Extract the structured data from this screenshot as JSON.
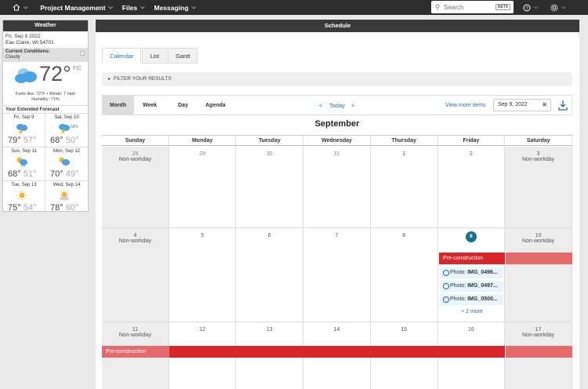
{
  "nav": {
    "items": [
      {
        "label": "Project Management"
      },
      {
        "label": "Files"
      },
      {
        "label": "Messaging"
      }
    ],
    "search_placeholder": "Search",
    "beta": "BETA"
  },
  "weather": {
    "title": "Weather",
    "date": "Fri, Sep 9 2022",
    "location": "Eau Claire, WI 54701",
    "conditions_label": "Current Conditions:",
    "conditions": "Cloudy",
    "temp": "72°",
    "unit": "F|C",
    "feels": "Feels like: 72°F • Winds: 7 mph",
    "humidity": "Humidity: 71%",
    "extended_label": "Your Extended Forecast",
    "forecast": [
      {
        "day": "Fri, Sep 9",
        "hi": "79°",
        "lo": "57°",
        "pct": "",
        "icon": "storm-cloud-icon"
      },
      {
        "day": "Sat, Sep 10",
        "hi": "68°",
        "lo": "50°",
        "pct": "58%",
        "icon": "storm-cloud-icon"
      },
      {
        "day": "Sun, Sep 11",
        "hi": "68°",
        "lo": "51°",
        "pct": "",
        "icon": "partly-cloudy-icon"
      },
      {
        "day": "Mon, Sep 12",
        "hi": "70°",
        "lo": "49°",
        "pct": "",
        "icon": "partly-cloudy-icon"
      },
      {
        "day": "Tue, Sep 13",
        "hi": "75°",
        "lo": "54°",
        "pct": "",
        "icon": "sun-icon"
      },
      {
        "day": "Wed, Sep 14",
        "hi": "78°",
        "lo": "60°",
        "pct": "",
        "icon": "sun-cloud-icon"
      }
    ]
  },
  "schedule": {
    "title": "Schedule",
    "tabs": [
      "Calendar",
      "List",
      "Gantt"
    ],
    "filter": "FILTER YOUR RESULTS",
    "views": [
      "Month",
      "Week",
      "Day",
      "Agenda"
    ],
    "today": "Today",
    "view_more": "View more items",
    "date_value": "Sep 9, 2022",
    "month": "September",
    "days": [
      "Sunday",
      "Monday",
      "Tuesday",
      "Wednesday",
      "Thursday",
      "Friday",
      "Saturday"
    ],
    "non_workday": "Non-workday",
    "weeks": [
      [
        "28",
        "29",
        "30",
        "31",
        "1",
        "2",
        "3"
      ],
      [
        "4",
        "5",
        "6",
        "7",
        "8",
        "9",
        "10"
      ],
      [
        "11",
        "12",
        "13",
        "14",
        "15",
        "16",
        "17"
      ]
    ],
    "event_label": "Pre-construction",
    "photo_label": "Photo:",
    "photos": [
      "IMG_0496...",
      "IMG_0497...",
      "IMG_0500..."
    ],
    "more": "+ 2 more"
  },
  "colors": {
    "nav_bg": "#2d2d2d",
    "accent_blue": "#2b6ea3",
    "event_red": "#d9262a",
    "today_badge": "#1a6e8e"
  }
}
